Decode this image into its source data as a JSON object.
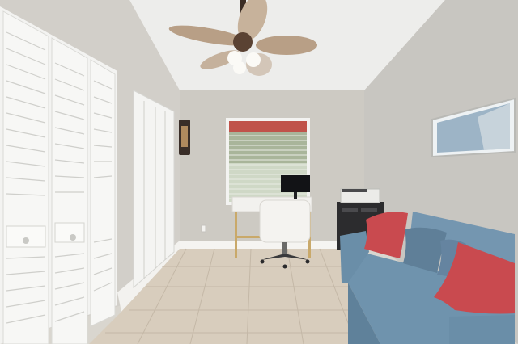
{
  "scene": {
    "description_label": "",
    "palette": {
      "wall": "#cfccc5",
      "wall_right": "#c9c7c2",
      "ceiling": "#eeeeec",
      "floor": "#d6cbbb",
      "closet_white": "#f4f4f2",
      "sofa_blue": "#6f93ad",
      "pillow_red": "#c94a4f",
      "pillow_blue": "#5f7f98",
      "desk_white": "#f2f1ee",
      "desk_leg": "#c9a96a",
      "cabinet_black": "#2c2c2e"
    },
    "objects": [
      "left-bifold-closet",
      "middle-closet",
      "wall-sconce",
      "ceiling-fan",
      "window-with-blinds",
      "desk",
      "monitor",
      "office-chair",
      "filing-cabinet",
      "printer",
      "framed-picture",
      "sofa",
      "red-pillow-left",
      "blue-pillow",
      "red-pillow-right",
      "tile-floor"
    ]
  }
}
